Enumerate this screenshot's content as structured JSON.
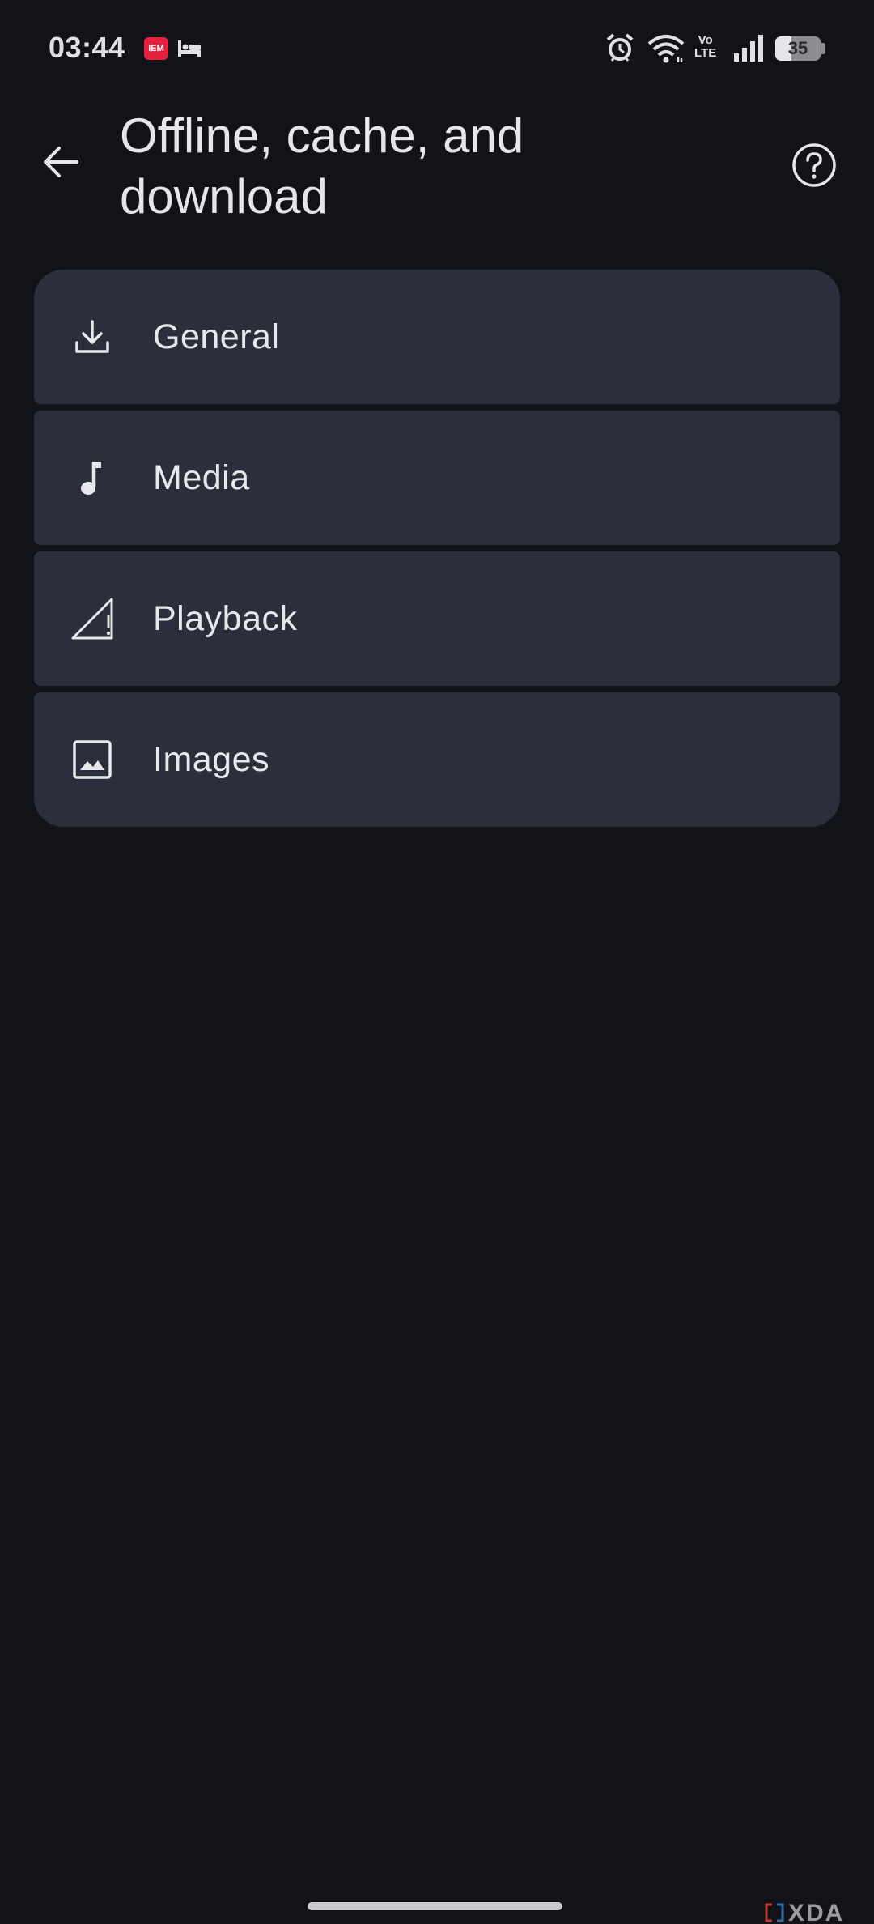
{
  "status_bar": {
    "time": "03:44",
    "notification_badge": "IEM",
    "network_label_top": "Vo",
    "network_label_bottom": "LTE",
    "battery_level": "35",
    "battery_fraction": 0.35
  },
  "header": {
    "title": "Offline, cache, and download",
    "back_icon": "arrow-back-icon",
    "help_icon": "help-circle-icon"
  },
  "menu": {
    "items": [
      {
        "label": "General",
        "icon": "download-icon"
      },
      {
        "label": "Media",
        "icon": "music-note-icon"
      },
      {
        "label": "Playback",
        "icon": "network-signal-icon"
      },
      {
        "label": "Images",
        "icon": "image-icon"
      }
    ]
  },
  "watermark": {
    "text": "XDA"
  },
  "colors": {
    "background": "#121318",
    "card": "#2b2f3b",
    "text": "#e6e6ea",
    "badge": "#e5213d"
  }
}
